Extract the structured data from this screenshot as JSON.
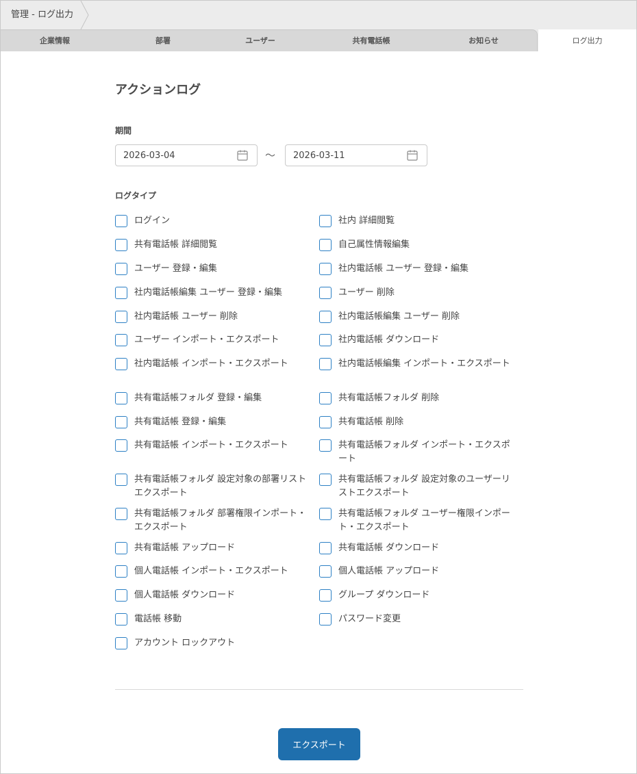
{
  "breadcrumb": {
    "text": "管理 - ログ出力"
  },
  "tabs": [
    {
      "label": "企業情報",
      "active": false
    },
    {
      "label": "部署",
      "active": false
    },
    {
      "label": "ユーザー",
      "active": false
    },
    {
      "label": "共有電話帳",
      "active": false
    },
    {
      "label": "お知らせ",
      "active": false
    },
    {
      "label": "ログ出力",
      "active": true
    }
  ],
  "main": {
    "title": "アクションログ",
    "period_label": "期間",
    "date_from": "2026-03-04",
    "date_separator": "〜",
    "date_to": "2026-03-11",
    "log_type_label": "ログタイプ",
    "log_types_left": [
      "ログイン",
      "共有電話帳 詳細閲覧",
      "ユーザー 登録・編集",
      "社内電話帳編集 ユーザー 登録・編集",
      "社内電話帳 ユーザー 削除",
      "ユーザー インポート・エクスポート",
      "社内電話帳 インポート・エクスポート",
      "共有電話帳フォルダ 登録・編集",
      "共有電話帳 登録・編集",
      "共有電話帳 インポート・エクスポート",
      "共有電話帳フォルダ 設定対象の部署リストエクスポート",
      "共有電話帳フォルダ 部署権限インポート・エクスポート",
      "共有電話帳 アップロード",
      "個人電話帳 インポート・エクスポート",
      "個人電話帳 ダウンロード",
      "電話帳 移動",
      "アカウント ロックアウト"
    ],
    "log_types_right": [
      "社内 詳細閲覧",
      "自己属性情報編集",
      "社内電話帳 ユーザー 登録・編集",
      "ユーザー 削除",
      "社内電話帳編集 ユーザー 削除",
      "社内電話帳 ダウンロード",
      "社内電話帳編集 インポート・エクスポート",
      "共有電話帳フォルダ 削除",
      "共有電話帳 削除",
      "共有電話帳フォルダ インポート・エクスポート",
      "共有電話帳フォルダ 設定対象のユーザーリストエクスポート",
      "共有電話帳フォルダ ユーザー権限インポート・エクスポート",
      "共有電話帳 ダウンロード",
      "個人電話帳 アップロード",
      "グループ ダウンロード",
      "パスワード変更"
    ],
    "export_button": "エクスポート"
  },
  "icons": {
    "calendar": "calendar-icon",
    "chevron": "chevron-right-icon"
  },
  "colors": {
    "accent": "#1f6fad",
    "checkbox_border": "#2b7fc4",
    "tab_inactive": "#d8d8d8",
    "header_bg": "#ececec"
  }
}
